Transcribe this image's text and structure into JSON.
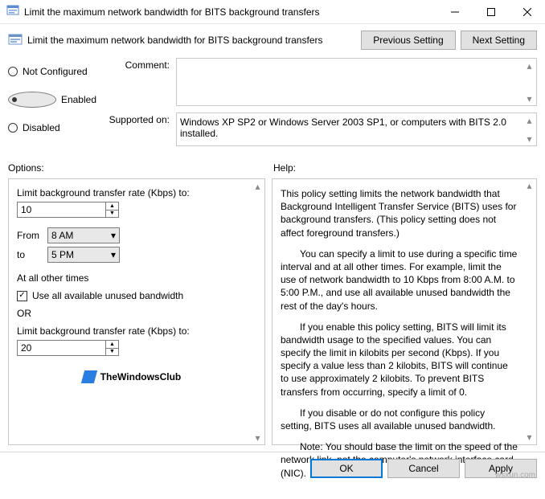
{
  "window": {
    "title": "Limit the maximum network bandwidth for BITS background transfers"
  },
  "header": {
    "title": "Limit the maximum network bandwidth for BITS background transfers",
    "prev": "Previous Setting",
    "next": "Next Setting"
  },
  "state": {
    "not_configured": "Not Configured",
    "enabled": "Enabled",
    "disabled": "Disabled"
  },
  "fields": {
    "comment_label": "Comment:",
    "comment_value": "",
    "supported_label": "Supported on:",
    "supported_value": "Windows XP SP2 or Windows Server 2003 SP1, or computers with BITS 2.0 installed."
  },
  "section": {
    "options": "Options:",
    "help": "Help:"
  },
  "options": {
    "rate1_label": "Limit background transfer rate (Kbps) to:",
    "rate1_value": "10",
    "from_label": "From",
    "from_value": "8 AM",
    "to_label": "to",
    "to_value": "5 PM",
    "other_times": "At all other times",
    "use_all_label": "Use all available unused bandwidth",
    "use_all_checked": true,
    "or": "OR",
    "rate2_label": "Limit background transfer rate (Kbps) to:",
    "rate2_value": "20",
    "logo_text": "TheWindowsClub"
  },
  "help": {
    "p1": "This policy setting limits the network bandwidth that Background Intelligent Transfer Service (BITS) uses for background transfers. (This policy setting does not affect foreground transfers.)",
    "p2": "You can specify a limit to use during a specific time interval and at all other times. For example, limit the use of network bandwidth to 10 Kbps from 8:00 A.M. to 5:00 P.M., and use all available unused bandwidth the rest of the day's hours.",
    "p3": "If you enable this policy setting, BITS will limit its bandwidth usage to the specified values. You can specify the limit in kilobits per second (Kbps). If you specify a value less than 2 kilobits, BITS will continue to use approximately 2 kilobits. To prevent BITS transfers from occurring, specify a limit of 0.",
    "p4": "If you disable or do not configure this policy setting, BITS uses all available unused bandwidth.",
    "p5": "Note: You should base the limit on the speed of the network link, not the computer's network interface card (NIC)."
  },
  "footer": {
    "ok": "OK",
    "cancel": "Cancel",
    "apply": "Apply"
  },
  "watermark": "wsxun.com"
}
